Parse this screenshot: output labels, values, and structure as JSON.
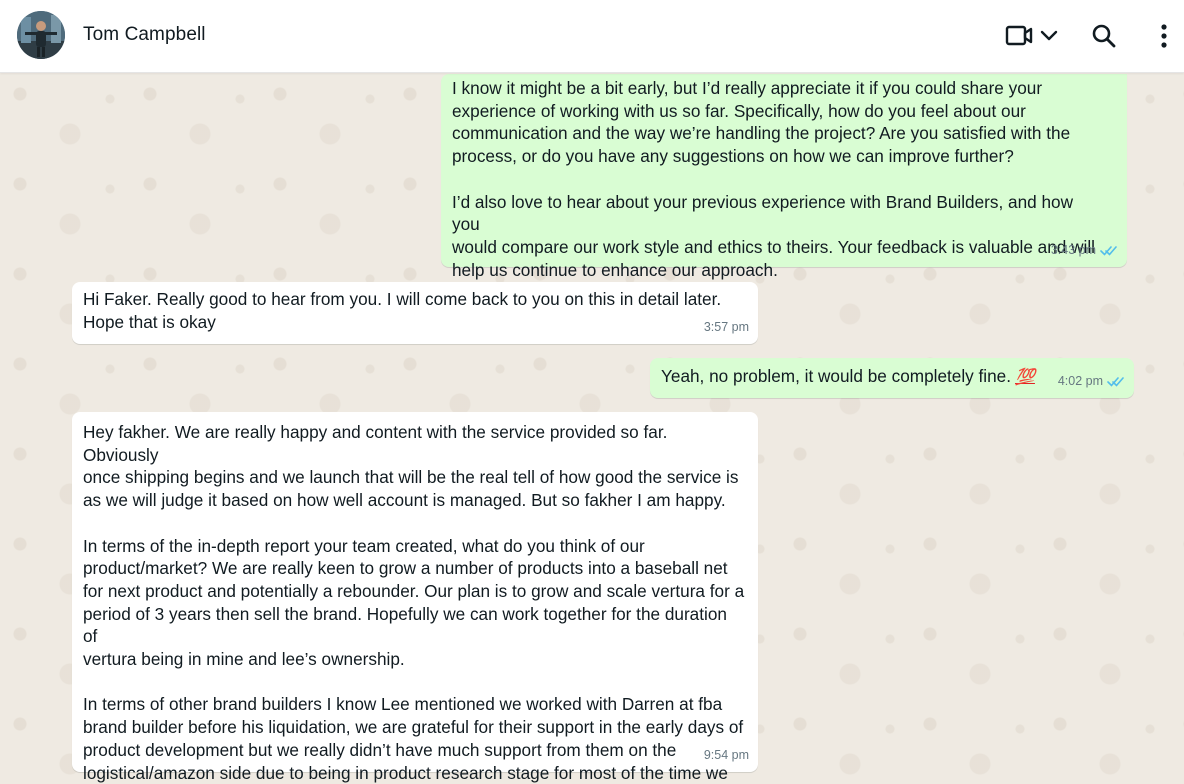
{
  "header": {
    "contact_name": "Tom Campbell",
    "icons": [
      "video-call-icon",
      "chevron-down-icon",
      "search-icon",
      "more-vertical-icon"
    ]
  },
  "messages": [
    {
      "direction": "outgoing",
      "text": "I know it might be a bit early, but I’d really appreciate it if you could share your\nexperience of working with us so far. Specifically, how do you feel about our\ncommunication and the way we’re handling the project? Are you satisfied with the\nprocess, or do you have any suggestions on how we can improve further?\n\nI’d also love to hear about your previous experience with Brand Builders, and how you\nwould compare our work style and ethics to theirs. Your feedback is valuable and will\nhelp us continue to enhance our approach.",
      "time": "3:43 pm",
      "status": "read"
    },
    {
      "direction": "incoming",
      "text": "Hi Faker. Really good to hear from you. I will come back to you on this in detail later.\nHope that is okay",
      "time": "3:57 pm"
    },
    {
      "direction": "outgoing",
      "text": "Yeah, no problem, it would be completely fine.",
      "emoji": "💯",
      "time": "4:02 pm",
      "status": "read"
    },
    {
      "direction": "incoming",
      "text": "Hey fakher. We are really happy and content with the service provided so far. Obviously\nonce shipping begins and we launch that will be the real tell of how good the service is\nas we will judge it based on how well account is managed. But so fakher I am happy.\n\nIn terms of the in-depth report your team created, what do you think of our\nproduct/market? We are really keen to grow a number of products into a baseball net\nfor next product and potentially a rebounder. Our plan is to grow and scale vertura for a\nperiod of 3 years then sell the brand. Hopefully we can work together for the duration of\nvertura being in mine and lee’s ownership.\n\nIn terms of other brand builders I know Lee mentioned we worked with Darren at fba\nbrand builder before his liquidation, we are grateful for their support in the early days of\nproduct development but we really didn’t have much support from them on the\nlogistical/amazon side due to being in product research stage for most of the time we\nwere with them.",
      "time": "9:54 pm"
    }
  ],
  "colors": {
    "outgoing_bubble": "#d9fdd3",
    "incoming_bubble": "#ffffff",
    "chat_background": "#efeae2",
    "read_ticks": "#53bdeb",
    "timestamp": "#667781"
  }
}
